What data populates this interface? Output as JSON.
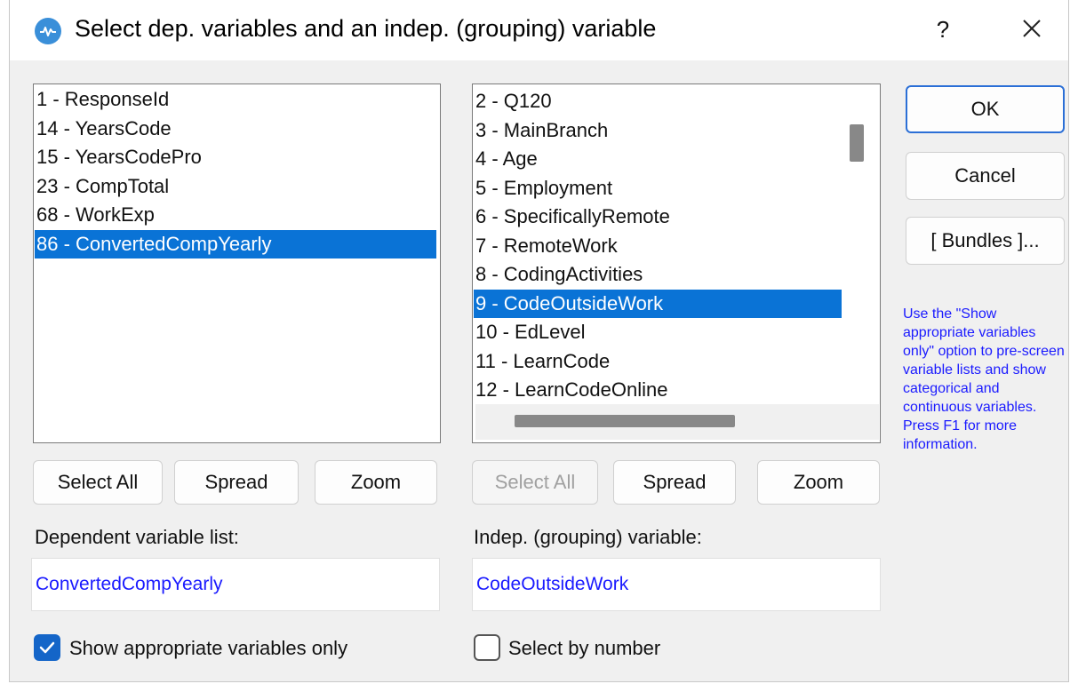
{
  "window": {
    "title": "Select dep. variables and an indep. (grouping) variable",
    "help_label": "?",
    "close_icon": "close-icon"
  },
  "left_list": {
    "items": [
      {
        "label": "1 - ResponseId",
        "selected": false
      },
      {
        "label": "14 - YearsCode",
        "selected": false
      },
      {
        "label": "15 - YearsCodePro",
        "selected": false
      },
      {
        "label": "23 - CompTotal",
        "selected": false
      },
      {
        "label": "68 - WorkExp",
        "selected": false
      },
      {
        "label": "86 - ConvertedCompYearly",
        "selected": true
      }
    ]
  },
  "right_list": {
    "items": [
      {
        "label": "2 - Q120",
        "selected": false
      },
      {
        "label": "3 - MainBranch",
        "selected": false
      },
      {
        "label": "4 - Age",
        "selected": false
      },
      {
        "label": "5 - Employment",
        "selected": false
      },
      {
        "label": "6 - SpecificallyRemote",
        "selected": false
      },
      {
        "label": "7 - RemoteWork",
        "selected": false
      },
      {
        "label": "8 - CodingActivities",
        "selected": false
      },
      {
        "label": "9 - CodeOutsideWork",
        "selected": true
      },
      {
        "label": "10 - EdLevel",
        "selected": false
      },
      {
        "label": "11 - LearnCode",
        "selected": false
      },
      {
        "label": "12 - LearnCodeOnline",
        "selected": false
      }
    ]
  },
  "left_buttons": {
    "select_all": "Select All",
    "spread": "Spread",
    "zoom": "Zoom"
  },
  "right_buttons": {
    "select_all": "Select All",
    "spread": "Spread",
    "zoom": "Zoom"
  },
  "dependent": {
    "label": "Dependent variable list:",
    "value": "ConvertedCompYearly"
  },
  "independent": {
    "label": "Indep. (grouping) variable:",
    "value": "CodeOutsideWork"
  },
  "side_buttons": {
    "ok": "OK",
    "cancel": "Cancel",
    "bundles": "[ Bundles ]..."
  },
  "hint": "Use the \"Show appropriate variables only\" option to pre-screen variable lists and show categorical and continuous variables. Press F1 for more information.",
  "options": {
    "show_appropriate": {
      "label": "Show appropriate variables only",
      "checked": true
    },
    "select_by_number": {
      "label": "Select by number",
      "checked": false
    }
  },
  "colors": {
    "selection": "#0a73d6",
    "field_text": "#1a1aff",
    "checkbox_checked": "#1465c8"
  }
}
